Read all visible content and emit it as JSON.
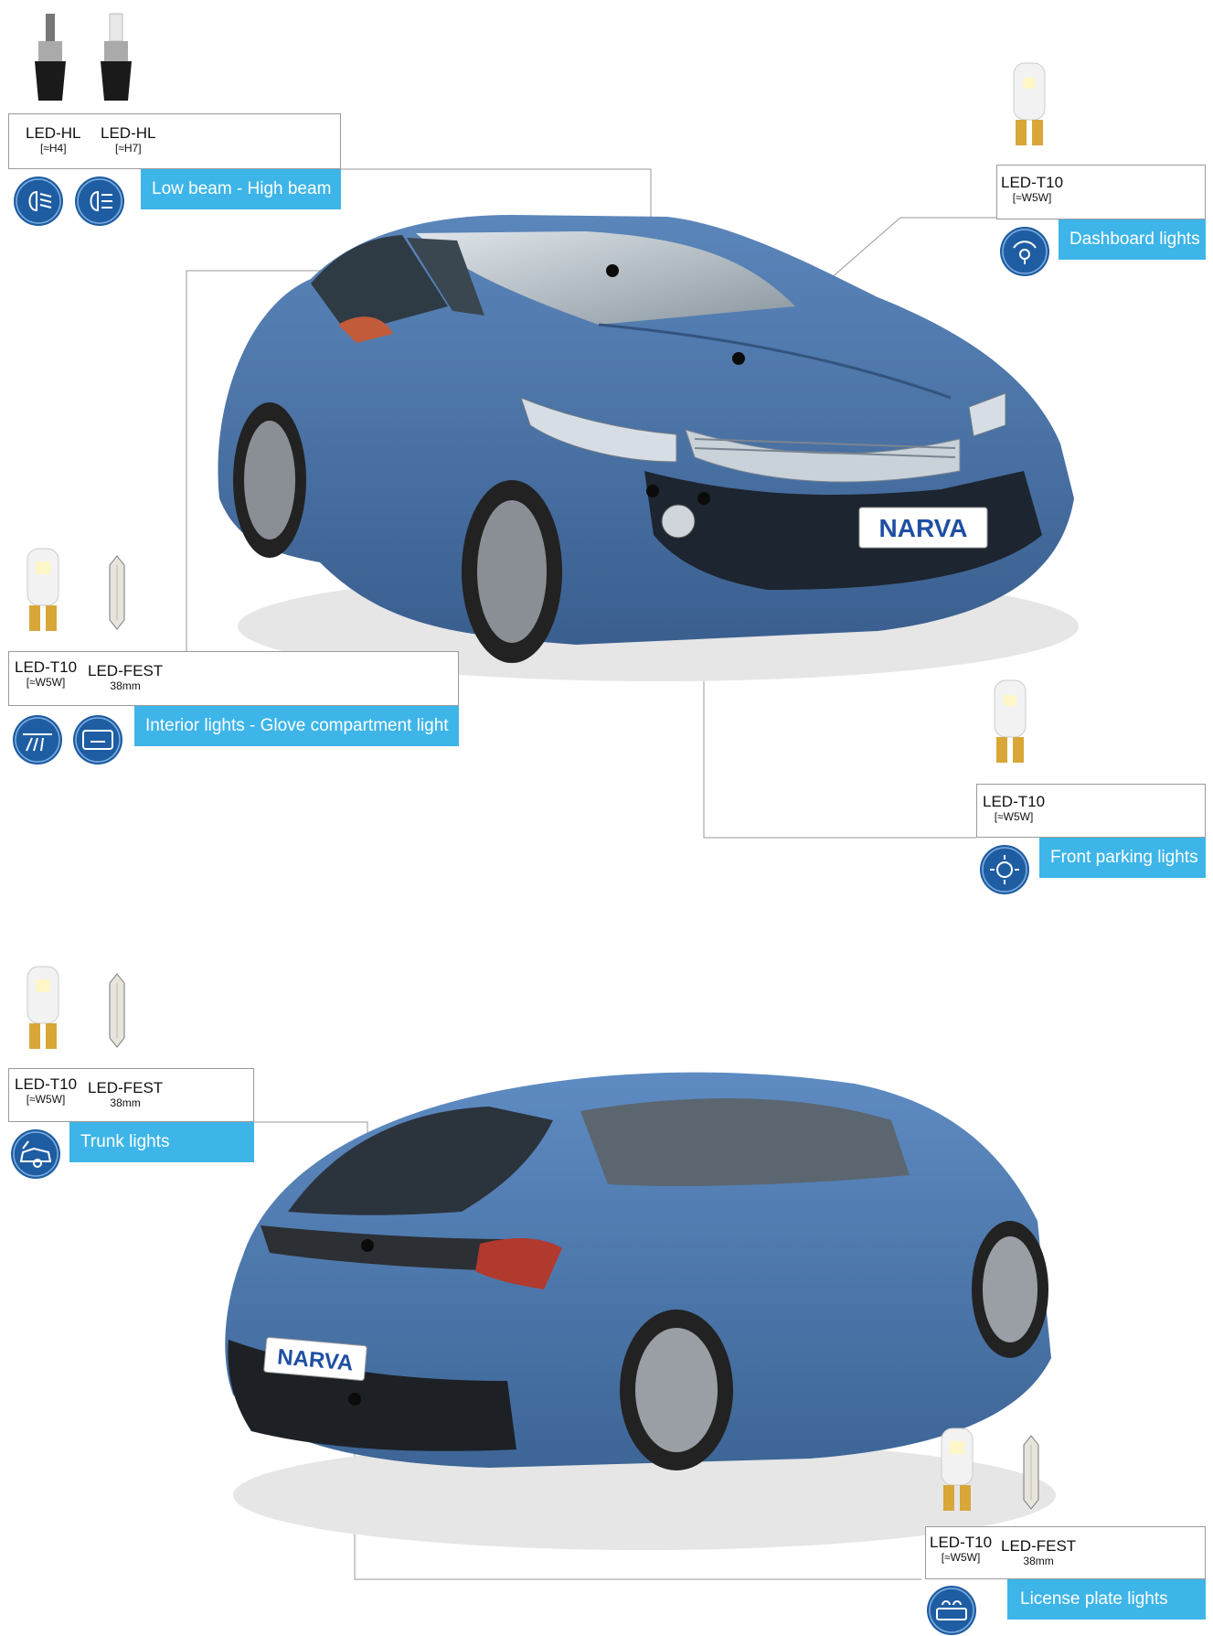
{
  "groups": {
    "headlights": {
      "items": [
        {
          "name": "LED-HL",
          "sub": "[≈H4]"
        },
        {
          "name": "LED-HL",
          "sub": "[≈H7]"
        }
      ],
      "label": "Low beam - High beam",
      "icons": [
        "low-beam-icon",
        "high-beam-icon"
      ]
    },
    "dashboard": {
      "items": [
        {
          "name": "LED-T10",
          "sub": "[≈W5W]"
        }
      ],
      "label": "Dashboard lights",
      "icons": [
        "dashboard-light-icon"
      ]
    },
    "interior": {
      "items": [
        {
          "name": "LED-T10",
          "sub": "[≈W5W]"
        },
        {
          "name": "LED-FEST",
          "sub": "38mm"
        }
      ],
      "label": "Interior lights - Glove compartment light",
      "icons": [
        "interior-light-icon",
        "glove-compartment-icon"
      ]
    },
    "parking": {
      "items": [
        {
          "name": "LED-T10",
          "sub": "[≈W5W]"
        }
      ],
      "label": "Front parking lights",
      "icons": [
        "parking-light-icon"
      ]
    },
    "trunk": {
      "items": [
        {
          "name": "LED-T10",
          "sub": "[≈W5W]"
        },
        {
          "name": "LED-FEST",
          "sub": "38mm"
        }
      ],
      "label": "Trunk lights",
      "icons": [
        "trunk-light-icon"
      ]
    },
    "license": {
      "items": [
        {
          "name": "LED-T10",
          "sub": "[≈W5W]"
        },
        {
          "name": "LED-FEST",
          "sub": "38mm"
        }
      ],
      "label": "License plate lights",
      "icons": [
        "license-plate-light-icon"
      ]
    }
  },
  "plates": {
    "front": "NARVA",
    "rear": "NARVA"
  },
  "colors": {
    "accent": "#3db5e8",
    "car": "#4a74a8",
    "icon": "#1f5da3"
  }
}
